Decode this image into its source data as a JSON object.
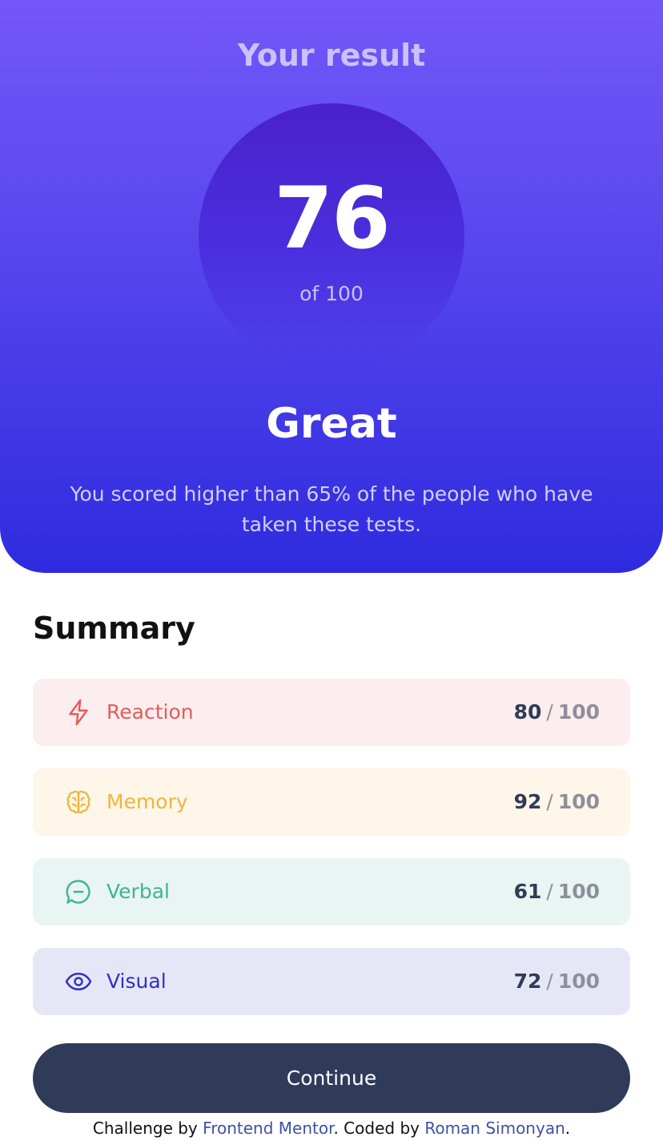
{
  "result": {
    "heading": "Your result",
    "score": "76",
    "max_label": "of 100",
    "rating": "Great",
    "description": "You scored higher than 65% of the people who have taken these tests."
  },
  "summary": {
    "title": "Summary",
    "items": [
      {
        "label": "Reaction",
        "score": "80",
        "separator": "/",
        "max": "100",
        "icon": "lightning-icon",
        "color": "#e85a5a",
        "bg": "#fcedee"
      },
      {
        "label": "Memory",
        "score": "92",
        "separator": "/",
        "max": "100",
        "icon": "brain-icon",
        "color": "#f0b53e",
        "bg": "#fdf6e9"
      },
      {
        "label": "Verbal",
        "score": "61",
        "separator": "/",
        "max": "100",
        "icon": "speech-bubble-icon",
        "color": "#3fb58e",
        "bg": "#e8f5f2"
      },
      {
        "label": "Visual",
        "score": "72",
        "separator": "/",
        "max": "100",
        "icon": "eye-icon",
        "color": "#2f2fcb",
        "bg": "#e6e7f6"
      }
    ]
  },
  "actions": {
    "continue_label": "Continue"
  },
  "footer": {
    "prefix": "Challenge by ",
    "link1": "Frontend Mentor",
    "middle": ". Coded by ",
    "link2": "Roman Simonyan",
    "suffix": "."
  },
  "colors": {
    "accent_gradient_top": "#7457f8",
    "accent_gradient_bottom": "#2e2bdf",
    "button": "#303b59"
  }
}
